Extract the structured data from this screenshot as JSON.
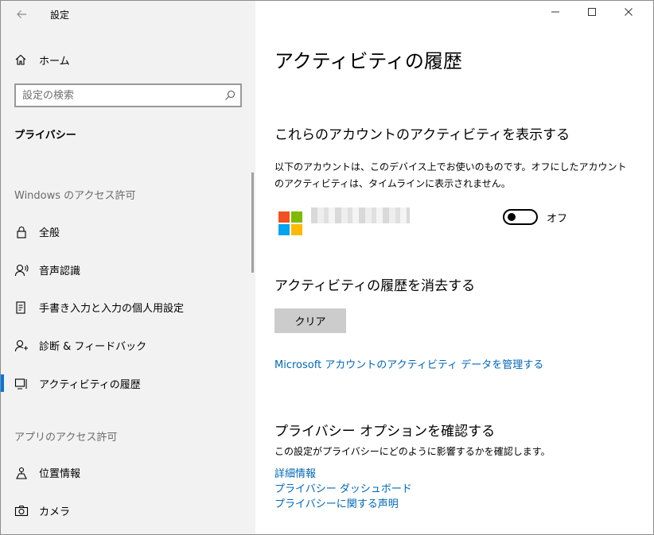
{
  "window": {
    "title": "設定"
  },
  "sidebar": {
    "home_label": "ホーム",
    "search_placeholder": "設定の検索",
    "section_title": "プライバシー",
    "group_windows": "Windows のアクセス許可",
    "group_apps": "アプリのアクセス許可",
    "items": [
      {
        "label": "全般",
        "icon": "lock-icon"
      },
      {
        "label": "音声認識",
        "icon": "speech-icon"
      },
      {
        "label": "手書き入力と入力の個人用設定",
        "icon": "inking-icon"
      },
      {
        "label": "診断 & フィードバック",
        "icon": "feedback-icon"
      },
      {
        "label": "アクティビティの履歴",
        "icon": "activity-history-icon",
        "selected": true
      },
      {
        "label": "位置情報",
        "icon": "location-icon"
      },
      {
        "label": "カメラ",
        "icon": "camera-icon"
      }
    ]
  },
  "content": {
    "page_title": "アクティビティの履歴",
    "accounts_heading": "これらのアカウントのアクティビティを表示する",
    "accounts_desc": "以下のアカウントは、このデバイス上でお使いのものです。オフにしたアカウントのアクティビティは、タイムラインに表示されません。",
    "toggle_state": "オフ",
    "clear_heading": "アクティビティの履歴を消去する",
    "clear_button": "クリア",
    "manage_link": "Microsoft アカウントのアクティビティ データを管理する",
    "privacy_heading": "プライバシー オプションを確認する",
    "privacy_desc": "この設定がプライバシーにどのように影響するかを確認します。",
    "links": [
      "詳細情報",
      "プライバシー ダッシュボード",
      "プライバシーに関する声明"
    ]
  },
  "colors": {
    "accent": "#0078d7",
    "link": "#0067b8",
    "ms_red": "#f25022",
    "ms_green": "#7fba00",
    "ms_blue": "#00a4ef",
    "ms_yellow": "#ffb900"
  }
}
